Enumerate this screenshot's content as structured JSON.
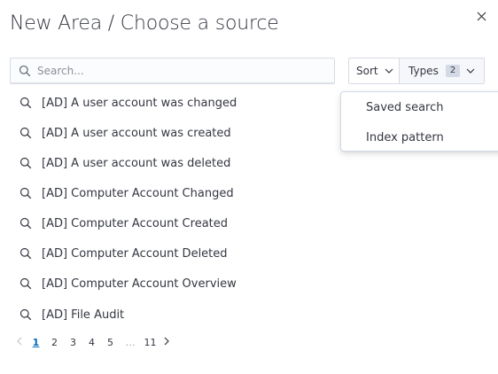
{
  "header": {
    "title": "New Area / Choose a source"
  },
  "icons": {
    "close": "close-icon",
    "search": "search-icon",
    "chevron": "chevron-down-icon",
    "prev": "chevron-left-icon",
    "next": "chevron-right-icon"
  },
  "search": {
    "placeholder": "Search...",
    "value": ""
  },
  "filters": {
    "sort_label": "Sort",
    "types_label": "Types",
    "types_count": "2"
  },
  "types_menu": {
    "items": [
      {
        "label": "Saved search"
      },
      {
        "label": "Index pattern"
      }
    ]
  },
  "results": {
    "items": [
      {
        "label": "[AD] A user account was changed"
      },
      {
        "label": "[AD] A user account was created"
      },
      {
        "label": "[AD] A user account was deleted"
      },
      {
        "label": "[AD] Computer Account Changed"
      },
      {
        "label": "[AD] Computer Account Created"
      },
      {
        "label": "[AD] Computer Account Deleted"
      },
      {
        "label": "[AD] Computer Account Overview"
      },
      {
        "label": "[AD] File Audit"
      }
    ]
  },
  "pagination": {
    "current": "1",
    "pages": [
      "1",
      "2",
      "3",
      "4",
      "5"
    ],
    "ellipsis": "…",
    "last": "11"
  },
  "colors": {
    "accent": "#006bb4",
    "text": "#343741",
    "border": "#d7dbe3"
  }
}
